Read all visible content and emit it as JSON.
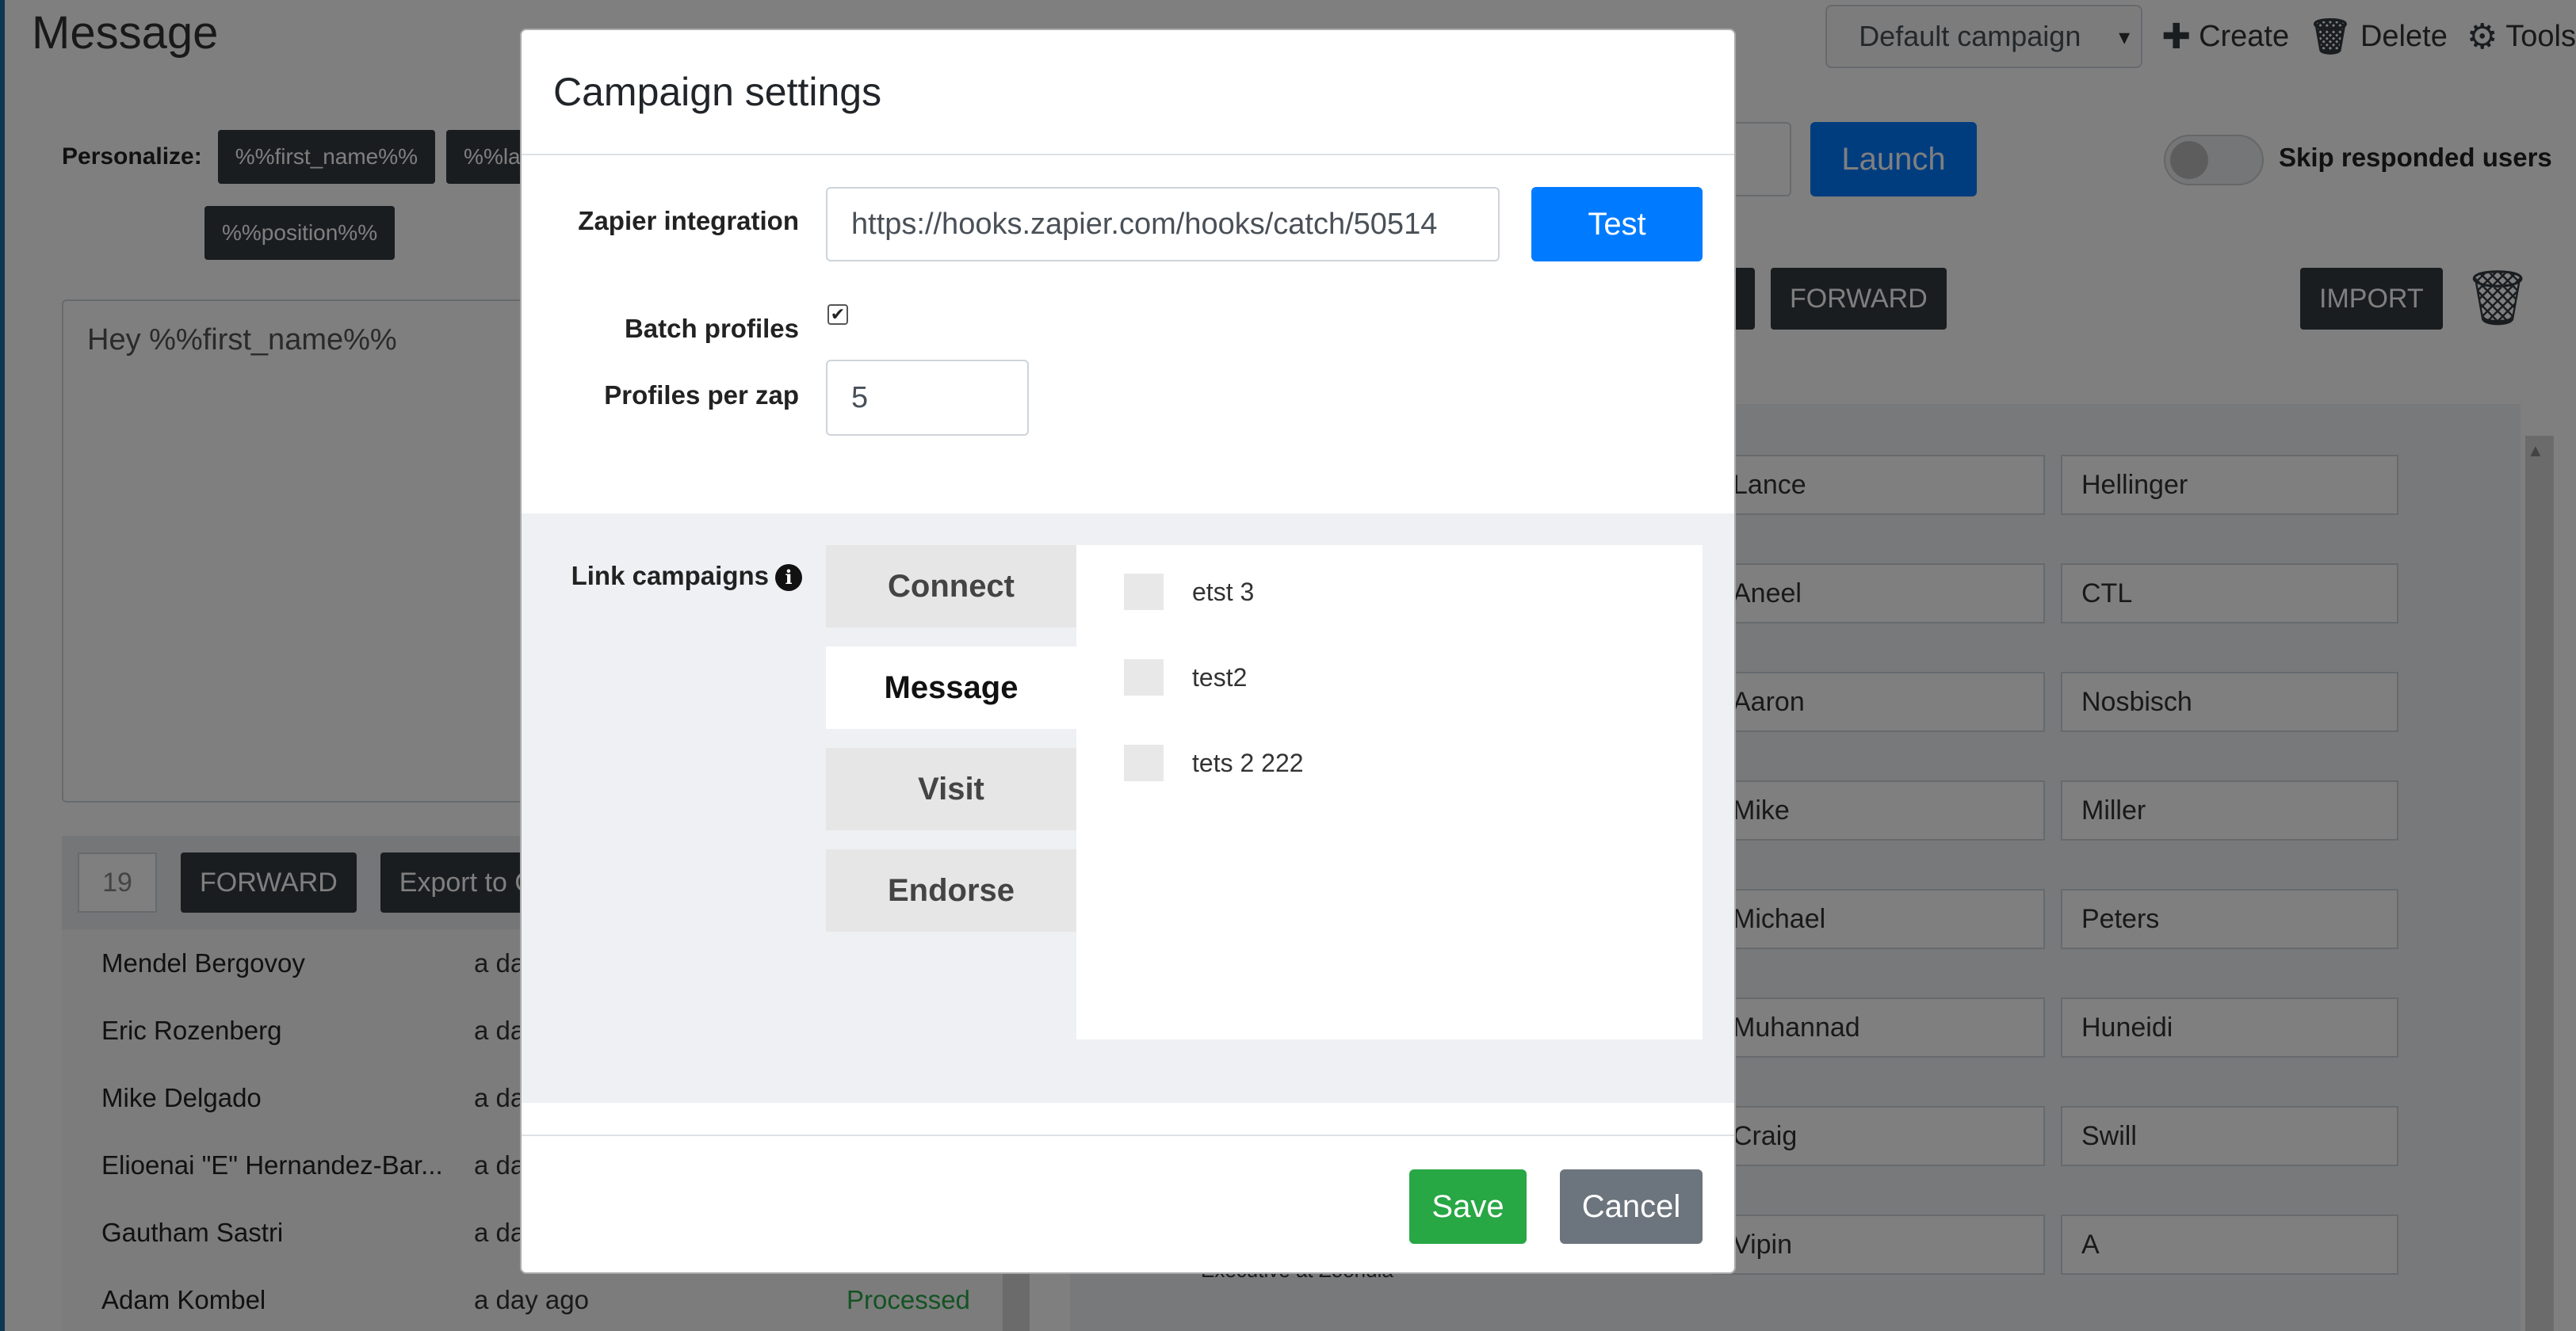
{
  "page": {
    "title": "Message",
    "campaign_select": "Default campaign",
    "actions": {
      "create": "Create",
      "delete": "Delete",
      "tools": "Tools"
    },
    "personalize_label": "Personalize:",
    "tags": [
      "%%first_name%%",
      "%%last",
      "%%position%%"
    ],
    "message_text": "Hey %%first_name%%",
    "launch_label": "Launch",
    "skip_responded_label": "Skip responded users",
    "forward_label": "FORWARD",
    "import_label": "IMPORT",
    "lead_count": "19",
    "export_label": "Export to C",
    "leads": [
      {
        "name": "Mendel Bergovoy",
        "time": "a da",
        "status": ""
      },
      {
        "name": "Eric Rozenberg",
        "time": "a da",
        "status": ""
      },
      {
        "name": "Mike Delgado",
        "time": "a da",
        "status": ""
      },
      {
        "name": "Elioenai \"E\" Hernandez-Bar...",
        "time": "a da",
        "status": ""
      },
      {
        "name": "Gautham Sastri",
        "time": "a da",
        "status": ""
      },
      {
        "name": "Adam Kombel",
        "time": "a day ago",
        "status": "Processed"
      }
    ],
    "people": [
      {
        "first": "Lance",
        "last": "Hellinger"
      },
      {
        "first": "Aneel",
        "last": "CTL"
      },
      {
        "first": "Aaron",
        "last": "Nosbisch"
      },
      {
        "first": "Mike",
        "last": "Miller"
      },
      {
        "first": "Michael",
        "last": "Peters"
      },
      {
        "first": "Muhannad",
        "last": "Huneidi"
      },
      {
        "first": "Craig",
        "last": "Swill"
      },
      {
        "first": "Vipin",
        "last": "A"
      }
    ],
    "partial_text": "Executive at Zoondia"
  },
  "modal": {
    "title": "Campaign settings",
    "zapier_label": "Zapier integration",
    "zapier_value": "https://hooks.zapier.com/hooks/catch/50514",
    "test_label": "Test",
    "batch_label": "Batch profiles",
    "batch_checked": "✔",
    "ppz_label": "Profiles per zap",
    "ppz_value": "5",
    "link_label": "Link campaigns",
    "info_glyph": "i",
    "tabs": [
      "Connect",
      "Message",
      "Visit",
      "Endorse"
    ],
    "active_tab": "Message",
    "campaigns": [
      "etst 3",
      "test2",
      "tets 2 222"
    ],
    "save_label": "Save",
    "cancel_label": "Cancel"
  },
  "colors": {
    "primary": "#007bff",
    "success": "#28a745",
    "secondary": "#6c757d",
    "dark": "#343a40"
  }
}
